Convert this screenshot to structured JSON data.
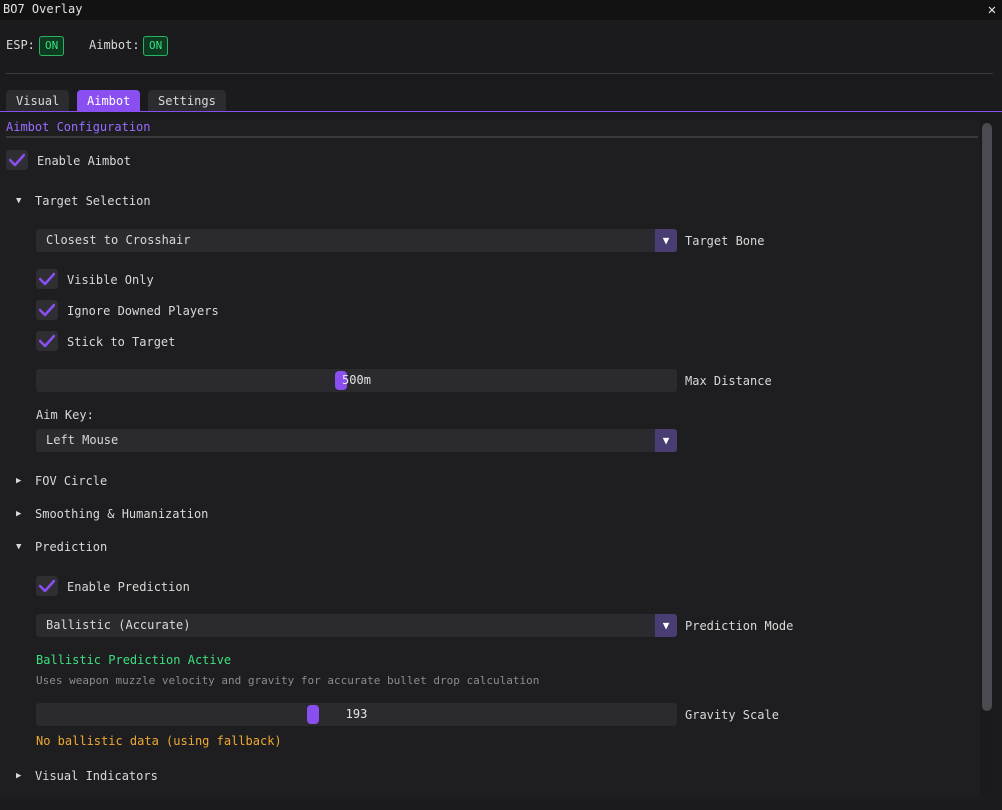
{
  "window": {
    "title": "BO7 Overlay",
    "close_glyph": "✕"
  },
  "toggles": {
    "esp_label": "ESP:",
    "esp_state": "ON",
    "aimbot_label": "Aimbot:",
    "aimbot_state": "ON",
    "on_color": "#3be07f"
  },
  "tabs": [
    {
      "label": "Visual",
      "active": false
    },
    {
      "label": "Aimbot",
      "active": true
    },
    {
      "label": "Settings",
      "active": false
    }
  ],
  "accent_color": "#8a4ff0",
  "section_title": "Aimbot Configuration",
  "enable_aimbot": {
    "label": "Enable Aimbot",
    "checked": true
  },
  "target_selection": {
    "header": "Target Selection",
    "expanded": true,
    "arrow": "▼",
    "target_bone": {
      "value": "Closest to Crosshair",
      "label": "Target Bone"
    },
    "visible_only": {
      "label": "Visible Only",
      "checked": true
    },
    "ignore_downed": {
      "label": "Ignore Downed Players",
      "checked": true
    },
    "stick_to_target": {
      "label": "Stick to Target",
      "checked": true
    },
    "max_distance": {
      "value_text": "500m",
      "label": "Max Distance",
      "fraction": 0.475
    },
    "aim_key_label": "Aim Key:",
    "aim_key_value": "Left Mouse"
  },
  "fov_circle": {
    "header": "FOV Circle",
    "expanded": false,
    "arrow": "▶"
  },
  "smoothing": {
    "header": "Smoothing & Humanization",
    "expanded": false,
    "arrow": "▶"
  },
  "prediction": {
    "header": "Prediction",
    "expanded": true,
    "arrow": "▼",
    "enable": {
      "label": "Enable Prediction",
      "checked": true
    },
    "mode": {
      "value": "Ballistic (Accurate)",
      "label": "Prediction Mode"
    },
    "status": "Ballistic Prediction Active",
    "description": "Uses weapon muzzle velocity and gravity for accurate bullet drop calculation",
    "gravity_scale": {
      "value_text": "193",
      "label": "Gravity Scale",
      "fraction": 0.43
    },
    "warning": "No ballistic data (using fallback)",
    "warning_color": "#f0a830"
  },
  "visual_indicators": {
    "header": "Visual Indicators",
    "expanded": false,
    "arrow": "▶"
  },
  "combo_arrow": "▼"
}
